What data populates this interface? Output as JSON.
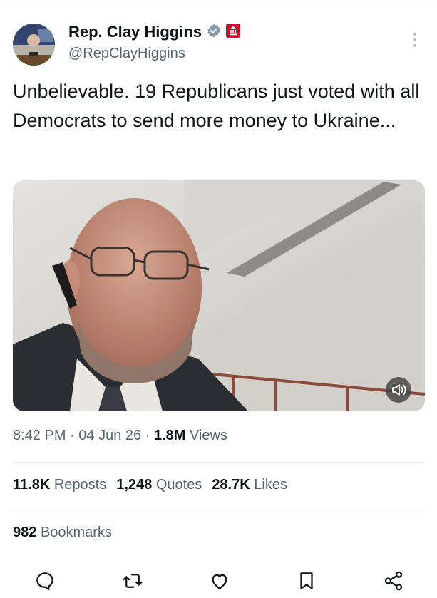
{
  "author": {
    "display_name": "Rep. Clay Higgins",
    "handle": "@RepClayHiggins",
    "verified_badge_color": "#829aab",
    "affiliation_badge_color": "#c8102e"
  },
  "tweet": {
    "text": "Unbelievable. 19 Republicans just voted with all Democrats to send more money to Ukraine..."
  },
  "meta": {
    "time": "8:42 PM",
    "date": "04 Jun 26",
    "views_count": "1.8M",
    "views_label": "Views"
  },
  "stats": {
    "reposts_count": "11.8K",
    "reposts_label": "Reposts",
    "quotes_count": "1,248",
    "quotes_label": "Quotes",
    "likes_count": "28.7K",
    "likes_label": "Likes",
    "bookmarks_count": "982",
    "bookmarks_label": "Bookmarks"
  },
  "icons": {
    "more": "more-vertical-icon",
    "mute": "speaker-muted-icon",
    "reply": "reply-icon",
    "repost": "repost-icon",
    "like": "heart-icon",
    "bookmark": "bookmark-icon",
    "share": "share-icon"
  },
  "colors": {
    "text_primary": "#0f1419",
    "text_secondary": "#536471",
    "divider": "#e6e9eb"
  }
}
